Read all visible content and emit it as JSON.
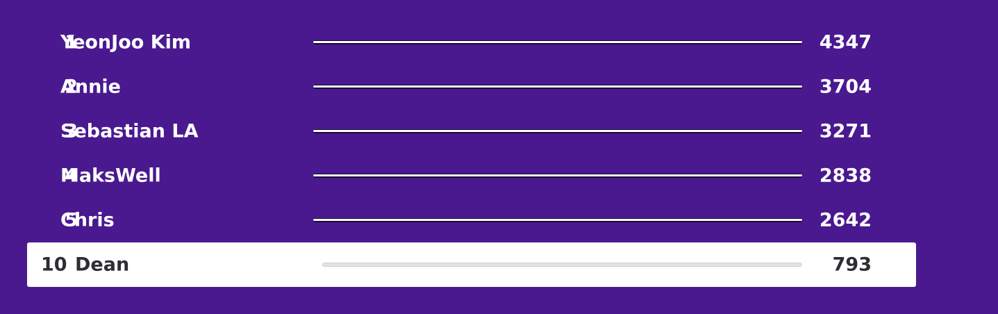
{
  "leaderboard": {
    "entries": [
      {
        "rank": "1",
        "name": "YeonJoo Kim",
        "score": "4347",
        "progress": 1.0
      },
      {
        "rank": "2",
        "name": "Annie",
        "score": "3704",
        "progress": 1.0
      },
      {
        "rank": "3",
        "name": "Sebastian LA",
        "score": "3271",
        "progress": 1.0
      },
      {
        "rank": "4",
        "name": "MaksWell",
        "score": "2838",
        "progress": 1.0
      },
      {
        "rank": "5",
        "name": "Chris",
        "score": "2642",
        "progress": 1.0
      }
    ],
    "current_user": {
      "rank": "10",
      "name": "Dean",
      "score": "793",
      "progress": 1.0
    }
  },
  "colors": {
    "background": "#4a198f",
    "text_on_dark": "#ffffff",
    "text_on_light": "#2e2d33",
    "highlight_row": "#ffffff"
  }
}
